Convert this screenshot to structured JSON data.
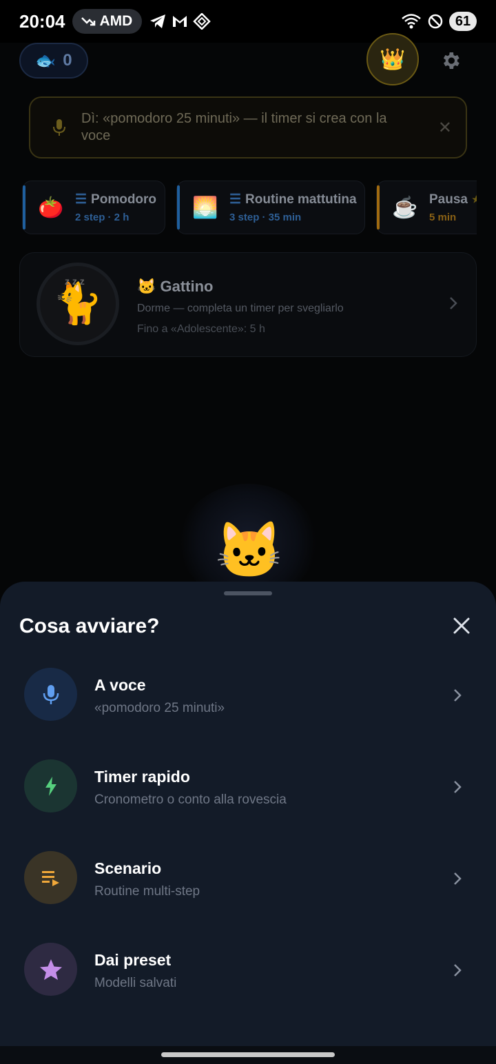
{
  "status_bar": {
    "time": "20:04",
    "amd_label": "AMD",
    "battery": "61"
  },
  "header": {
    "fish_count": "0",
    "crown_icon": "crown-icon",
    "settings_icon": "gear-icon"
  },
  "voice_hint": {
    "text": "Dì: «pomodoro 25 minuti» — il timer si crea con la voce"
  },
  "chips": [
    {
      "emoji": "🍅",
      "title": "Pomodoro",
      "sub": "2 step · 2 h",
      "accent": "#1f5f9e",
      "sub_color": "#2e5f96"
    },
    {
      "emoji": "🌅",
      "title": "Routine mattutina",
      "sub": "3 step · 35 min",
      "accent": "#1f5f9e",
      "sub_color": "#2e5f96"
    },
    {
      "emoji": "☕",
      "title": "Pausa",
      "sub": "5 min",
      "accent": "#a06a10",
      "sub_color": "#8a6115"
    }
  ],
  "pet": {
    "name": "🐱 Gattino",
    "status": "Dorme — completa un timer per svegliarlo",
    "goal": "Fino a «Adolescente»: 5 h"
  },
  "sheet": {
    "title": "Cosa avviare?",
    "options": [
      {
        "title": "A voce",
        "sub": "«pomodoro 25 minuti»",
        "icon": "mic-icon",
        "bg": "#182a46",
        "fg": "#5f9ef0"
      },
      {
        "title": "Timer rapido",
        "sub": "Cronometro o conto alla rovescia",
        "icon": "bolt-icon",
        "bg": "#1b3532",
        "fg": "#56d07e"
      },
      {
        "title": "Scenario",
        "sub": "Routine multi-step",
        "icon": "playlist-icon",
        "bg": "#3a3426",
        "fg": "#f0a83a"
      },
      {
        "title": "Dai preset",
        "sub": "Modelli salvati",
        "icon": "star-icon",
        "bg": "#2e2a42",
        "fg": "#c48ee8"
      }
    ]
  }
}
